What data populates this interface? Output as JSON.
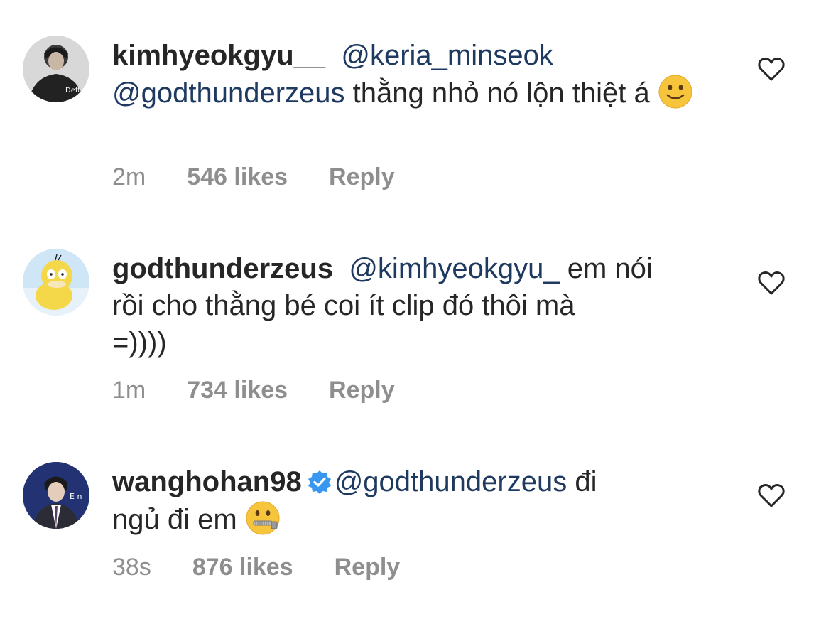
{
  "comments": [
    {
      "username": "kimhyeokgyu__",
      "mentions": [
        "@keria_minseok",
        "@godthunderzeus"
      ],
      "text": "thằng nhỏ nó lộn thiệt á",
      "emoji": "slightly-smiling-face",
      "time": "2m",
      "likes": "546 likes",
      "reply": "Reply",
      "avatar_text": "Deft"
    },
    {
      "username": "godthunderzeus",
      "mentions": [
        "@kimhyeokgyu_"
      ],
      "text_line1": "em nói",
      "text_line2": "rồi cho thằng bé coi ít clip đó thôi mà",
      "text_line3": "=))))",
      "time": "1m",
      "likes": "734 likes",
      "reply": "Reply",
      "avatar_desc": "psyduck"
    },
    {
      "username": "wanghohan98",
      "verified": true,
      "mentions": [
        "@godthunderzeus"
      ],
      "text_line1": "đi",
      "text_line2": "ngủ đi em",
      "emoji": "zipper-mouth-face",
      "time": "38s",
      "likes": "876 likes",
      "reply": "Reply",
      "avatar_text": "E n"
    }
  ],
  "colors": {
    "text": "#262626",
    "mention": "#1f3a60",
    "meta": "#8e8e8e",
    "verified": "#3897f0",
    "emoji": "#f7c53c"
  }
}
